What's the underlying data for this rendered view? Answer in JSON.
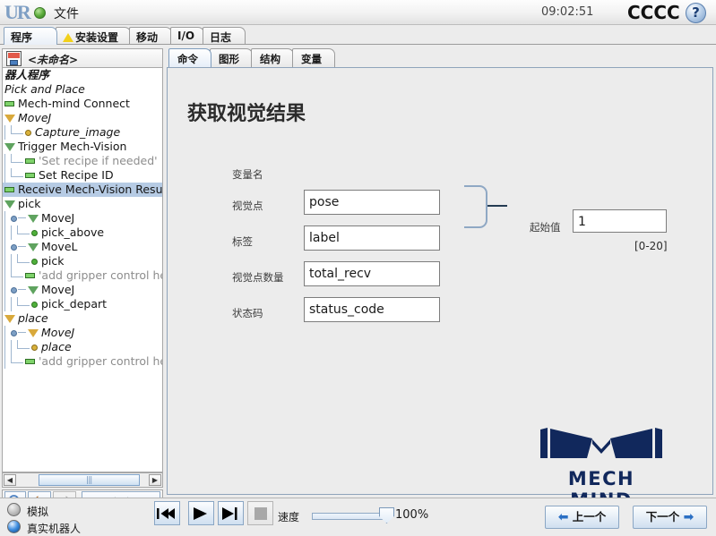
{
  "titlebar": {
    "logo": "ur-logo",
    "file_menu": "文件",
    "clock": "09:02:51",
    "brand": "CCCC",
    "help": "?"
  },
  "top_tabs": [
    {
      "label": "程序",
      "active": true,
      "warn": false
    },
    {
      "label": "安装设置",
      "active": false,
      "warn": true
    },
    {
      "label": "移动",
      "active": false,
      "warn": false
    },
    {
      "label": "I/O",
      "active": false,
      "warn": false
    },
    {
      "label": "日志",
      "active": false,
      "warn": false
    }
  ],
  "file_bar": {
    "name": "<未命名>",
    "icon": "floppy-save-icon"
  },
  "tree": {
    "rows": [
      {
        "label": "器人程序",
        "indent": 0,
        "style": "italic-bold",
        "marker": "none",
        "selected": false
      },
      {
        "label": "Pick and Place",
        "indent": 0,
        "style": "italic",
        "marker": "none",
        "selected": false
      },
      {
        "label": "Mech-mind Connect",
        "indent": 0,
        "style": "normal",
        "marker": "dash",
        "selected": false
      },
      {
        "label": "MoveJ",
        "indent": 0,
        "style": "italic",
        "marker": "tri-gold",
        "selected": false
      },
      {
        "label": "Capture_image",
        "indent": 1,
        "style": "italic",
        "marker": "elbow-dot-gold",
        "selected": false
      },
      {
        "label": "Trigger Mech-Vision",
        "indent": 0,
        "style": "normal",
        "marker": "tri-green",
        "selected": false
      },
      {
        "label": "'Set recipe if needed'",
        "indent": 1,
        "style": "gray",
        "marker": "elbow-dash",
        "selected": false
      },
      {
        "label": "Set Recipe ID",
        "indent": 1,
        "style": "normal",
        "marker": "elbow-dash",
        "selected": false
      },
      {
        "label": "Receive Mech-Vision Resul",
        "indent": 0,
        "style": "normal",
        "marker": "dash",
        "selected": true
      },
      {
        "label": "pick",
        "indent": 0,
        "style": "normal",
        "marker": "tri-green",
        "selected": false
      },
      {
        "label": "MoveJ",
        "indent": 1,
        "style": "normal",
        "marker": "knob-tri-green",
        "selected": false
      },
      {
        "label": "pick_above",
        "indent": 2,
        "style": "normal",
        "marker": "elbow-dot-green",
        "selected": false
      },
      {
        "label": "MoveL",
        "indent": 1,
        "style": "normal",
        "marker": "knob-tri-green",
        "selected": false
      },
      {
        "label": "pick",
        "indent": 2,
        "style": "normal",
        "marker": "elbow-dot-green",
        "selected": false
      },
      {
        "label": "'add gripper control he",
        "indent": 1,
        "style": "gray",
        "marker": "elbow-dash",
        "selected": false
      },
      {
        "label": "MoveJ",
        "indent": 1,
        "style": "normal",
        "marker": "knob-tri-green",
        "selected": false
      },
      {
        "label": "pick_depart",
        "indent": 2,
        "style": "normal",
        "marker": "elbow-dot-green",
        "selected": false
      },
      {
        "label": "place",
        "indent": 0,
        "style": "italic",
        "marker": "tri-gold",
        "selected": false
      },
      {
        "label": "MoveJ",
        "indent": 1,
        "style": "italic",
        "marker": "knob-tri-gold",
        "selected": false
      },
      {
        "label": "place",
        "indent": 2,
        "style": "italic",
        "marker": "elbow-dot-gold",
        "selected": false
      },
      {
        "label": "'add gripper control he",
        "indent": 1,
        "style": "gray",
        "marker": "elbow-dash",
        "selected": false
      }
    ]
  },
  "tree_scrollbar": {
    "left_arrow": "◀",
    "right_arrow": "▶",
    "grip": "|||"
  },
  "tree_toolbar": {
    "search": "🔍",
    "undo": "undo-arrow-icon",
    "redo": "redo-arrow-icon",
    "move": "◀----▶"
  },
  "main_tabs": [
    {
      "label": "命令",
      "active": true
    },
    {
      "label": "图形",
      "active": false
    },
    {
      "label": "结构",
      "active": false
    },
    {
      "label": "变量",
      "active": false
    }
  ],
  "page": {
    "title": "获取视觉结果",
    "section_label": "变量名",
    "fields": [
      {
        "label": "视觉点",
        "value": "pose"
      },
      {
        "label": "标签",
        "value": "label"
      },
      {
        "label": "视觉点数量",
        "value": "total_recv"
      },
      {
        "label": "状态码",
        "value": "status_code"
      }
    ],
    "start_value_label": "起始值",
    "start_value": "1",
    "range_hint": "[0-20]",
    "logo_text": "MECH MIND"
  },
  "bottom": {
    "sim_label": "模拟",
    "real_label": "真实机器人",
    "selected_mode": "真实机器人",
    "transport": {
      "rewind": "⏮",
      "play": "▶",
      "step": "⏭",
      "stop": "■"
    },
    "speed_label": "速度",
    "speed_value": "100%",
    "prev_button": "上一个",
    "next_button": "下一个"
  },
  "colors": {
    "accent_blue": "#2a6fc4",
    "selection": "#b6cbe4",
    "logo_navy": "#11285c",
    "tree_green": "#5fa35f",
    "tree_gold": "#d9a93b"
  }
}
